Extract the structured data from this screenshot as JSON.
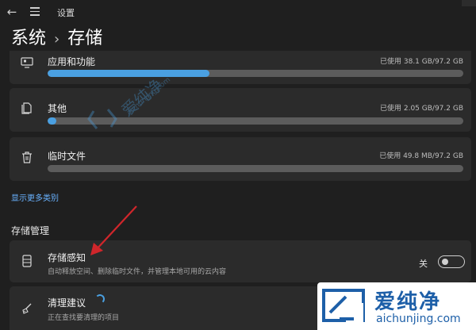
{
  "window": {
    "title": "设置"
  },
  "breadcrumb": {
    "parent": "系统",
    "separator": "›",
    "current": "存储"
  },
  "categories": [
    {
      "label": "应用和功能",
      "usage": "已使用 38.1 GB/97.2 GB",
      "fill": 0.39,
      "icon": "monitor-apps-icon"
    },
    {
      "label": "其他",
      "usage": "已使用 2.05 GB/97.2 GB",
      "fill": 0.021,
      "icon": "document-icon"
    },
    {
      "label": "临时文件",
      "usage": "已使用 49.8 MB/97.2 GB",
      "fill": 0.0,
      "icon": "trash-icon"
    }
  ],
  "more_categories_link": "显示更多类别",
  "storage_management": {
    "title": "存储管理",
    "storage_sense": {
      "label": "存储感知",
      "description": "自动释放空间、删除临时文件，并管理本地可用的云内容",
      "toggle_label": "关",
      "toggle_on": false
    },
    "cleanup": {
      "label": "清理建议",
      "description": "正在查找要清理的项目"
    }
  },
  "watermark": {
    "brand": "爱纯净",
    "site": "aichunjing.com"
  },
  "colors": {
    "accent": "#4aa0e2",
    "background": "#1f1f1f",
    "card": "#2b2b2b",
    "arrow": "#d0262b",
    "brand_blue": "#1d5fa8"
  }
}
